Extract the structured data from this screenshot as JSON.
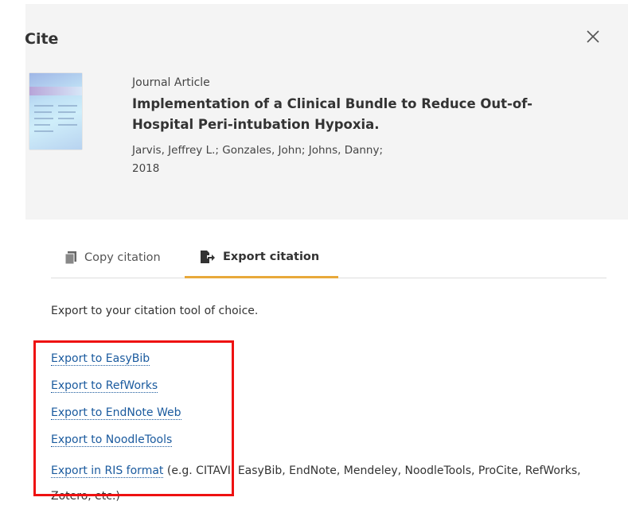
{
  "modal": {
    "title": "Cite"
  },
  "record": {
    "type": "Journal Article",
    "title": "Implementation of a Clinical Bundle to Reduce Out-of-Hospital Peri-intubation Hypoxia.",
    "authors": "Jarvis, Jeffrey L.; Gonzales, John; Johns, Danny;",
    "year": "2018"
  },
  "tabs": [
    {
      "label": "Copy citation",
      "icon": "copy-icon",
      "active": false
    },
    {
      "label": "Export citation",
      "icon": "export-icon",
      "active": true
    }
  ],
  "export": {
    "intro": "Export to your citation tool of choice.",
    "links": [
      "Export to EasyBib",
      "Export to RefWorks",
      "Export to EndNote Web",
      "Export to NoodleTools"
    ],
    "ris_link": "Export in RIS format",
    "ris_note": "(e.g. CITAVI, EasyBib, EndNote, Mendeley, NoodleTools, ProCite, RefWorks, Zotero, etc.)"
  },
  "colors": {
    "accent": "#e8a93a",
    "link": "#1a5a9e",
    "highlight": "#ee1111"
  }
}
